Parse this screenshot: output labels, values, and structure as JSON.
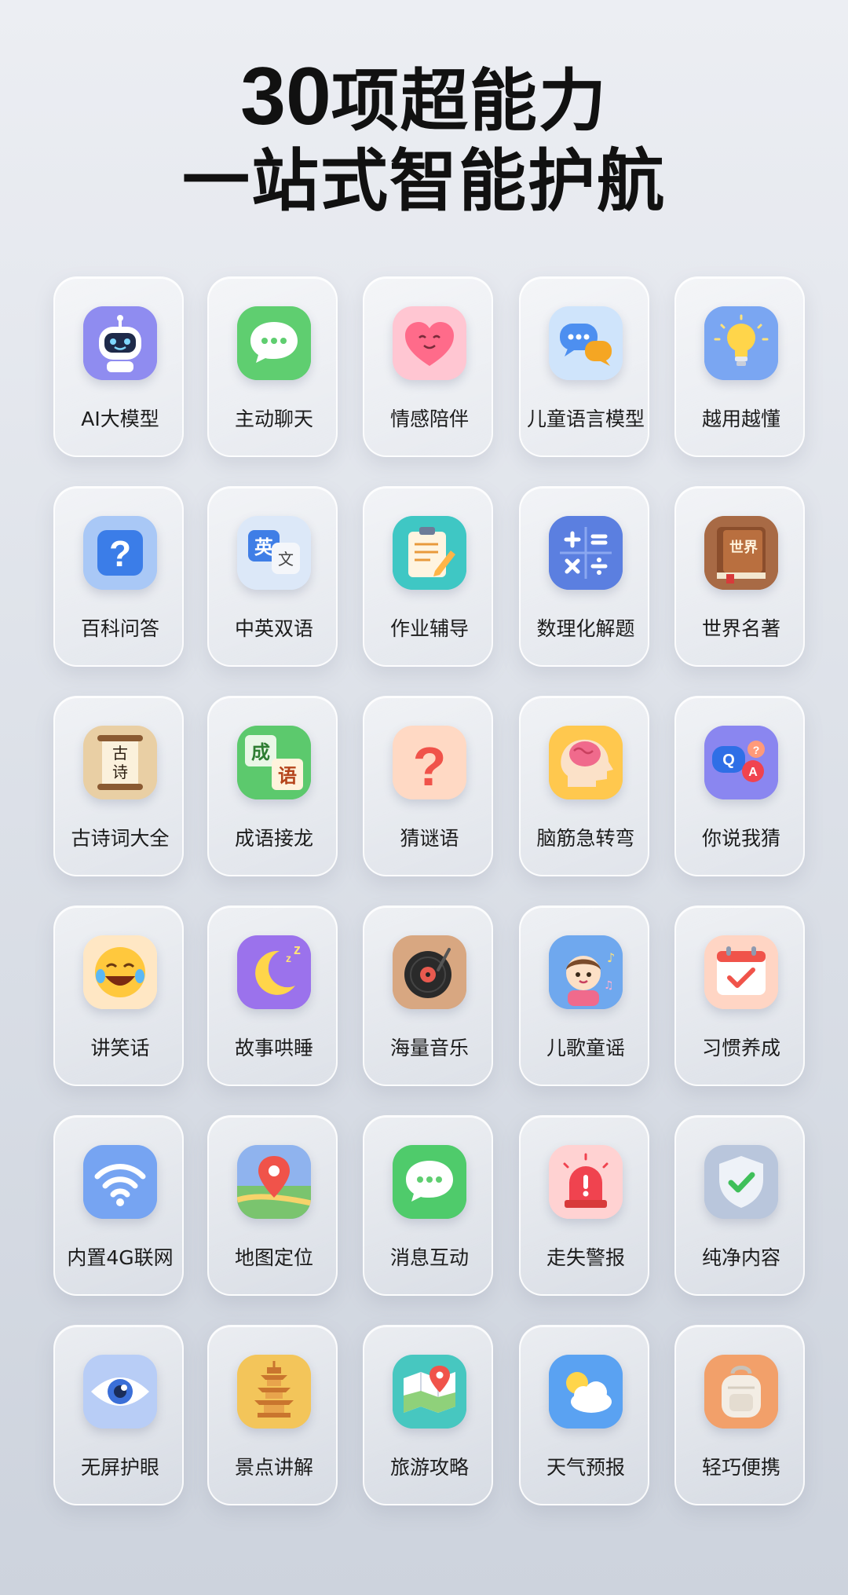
{
  "header": {
    "title_number": "30",
    "title_line1_rest": "项超能力",
    "title_line2": "一站式智能护航"
  },
  "features": [
    {
      "label": "AI大模型",
      "icon": "robot-icon",
      "color": "#8f8cf0"
    },
    {
      "label": "主动聊天",
      "icon": "chat-bubble-icon",
      "color": "#5fce70"
    },
    {
      "label": "情感陪伴",
      "icon": "heart-face-icon",
      "color": "#ffc6d2"
    },
    {
      "label": "儿童语言模型",
      "icon": "speech-bubbles-icon",
      "color": "#cfe4fb"
    },
    {
      "label": "越用越懂",
      "icon": "lightbulb-icon",
      "color": "#7aa6f2"
    },
    {
      "label": "百科问答",
      "icon": "question-box-icon",
      "color": "#a9c8f6"
    },
    {
      "label": "中英双语",
      "icon": "translate-icon",
      "color": "#dce8f8"
    },
    {
      "label": "作业辅导",
      "icon": "clipboard-pencil-icon",
      "color": "#3fc7c4"
    },
    {
      "label": "数理化解题",
      "icon": "calculator-icon",
      "color": "#5b7fe0"
    },
    {
      "label": "世界名著",
      "icon": "book-icon",
      "color": "#a86a45",
      "text": "世界"
    },
    {
      "label": "古诗词大全",
      "icon": "scroll-icon",
      "color": "#e9cfa4",
      "text": "古诗"
    },
    {
      "label": "成语接龙",
      "icon": "idiom-cards-icon",
      "color": "#5cc96d",
      "text": "成语"
    },
    {
      "label": "猜谜语",
      "icon": "question-mark-icon",
      "color": "#ffd9c4"
    },
    {
      "label": "脑筋急转弯",
      "icon": "brain-icon",
      "color": "#ffc84e"
    },
    {
      "label": "你说我猜",
      "icon": "qa-bubbles-icon",
      "color": "#8a86f0",
      "text": "Q A"
    },
    {
      "label": "讲笑话",
      "icon": "laughing-emoji-icon",
      "color": "#ffe7c4"
    },
    {
      "label": "故事哄睡",
      "icon": "moon-icon",
      "color": "#9b72ec"
    },
    {
      "label": "海量音乐",
      "icon": "vinyl-record-icon",
      "color": "#d8a781"
    },
    {
      "label": "儿歌童谣",
      "icon": "child-singing-icon",
      "color": "#6fa8ee"
    },
    {
      "label": "习惯养成",
      "icon": "calendar-check-icon",
      "color": "#ffd5c4"
    },
    {
      "label": "内置4G联网",
      "icon": "wifi-icon",
      "color": "#76a4f2"
    },
    {
      "label": "地图定位",
      "icon": "map-pin-icon",
      "color": "#8fb3ee"
    },
    {
      "label": "消息互动",
      "icon": "message-bubble-icon",
      "color": "#4fcb6b"
    },
    {
      "label": "走失警报",
      "icon": "alarm-siren-icon",
      "color": "#ffd2d2"
    },
    {
      "label": "纯净内容",
      "icon": "shield-check-icon",
      "color": "#b9c6dc"
    },
    {
      "label": "无屏护眼",
      "icon": "eye-icon",
      "color": "#b8cdf6"
    },
    {
      "label": "景点讲解",
      "icon": "pagoda-icon",
      "color": "#f3c55a"
    },
    {
      "label": "旅游攻略",
      "icon": "map-icon",
      "color": "#47c7c0"
    },
    {
      "label": "天气预报",
      "icon": "weather-icon",
      "color": "#5aa2f2"
    },
    {
      "label": "轻巧便携",
      "icon": "backpack-icon",
      "color": "#f2a06a"
    }
  ]
}
